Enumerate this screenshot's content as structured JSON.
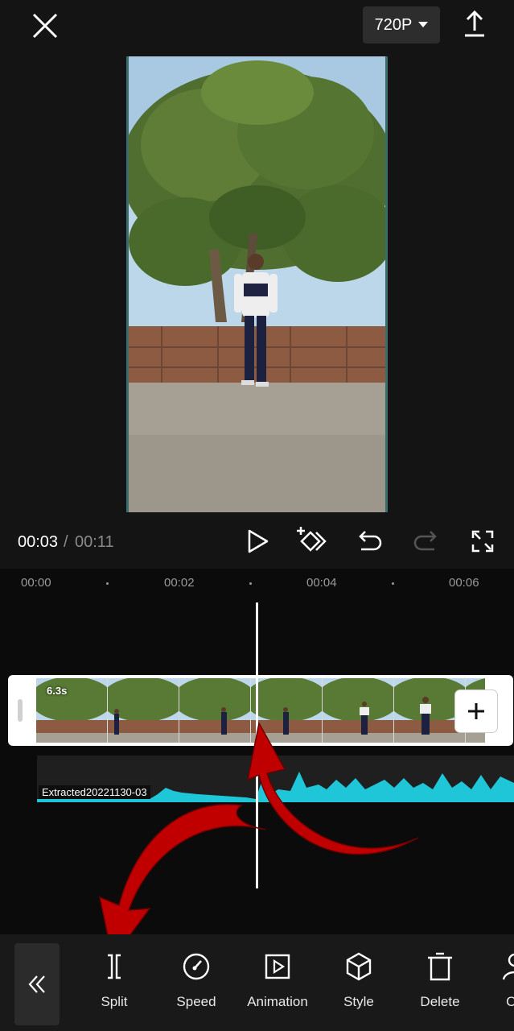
{
  "header": {
    "resolution_label": "720P"
  },
  "playback": {
    "current_time": "00:03",
    "separator": "/",
    "total_time": "00:11"
  },
  "timeline": {
    "ticks": [
      "00:00",
      "00:02",
      "00:04",
      "00:06"
    ],
    "clip_duration": "6.3s",
    "audio_label": "Extracted20221130-03"
  },
  "toolbar": {
    "items": [
      {
        "label": "Split",
        "icon": "split-icon"
      },
      {
        "label": "Speed",
        "icon": "speed-icon"
      },
      {
        "label": "Animation",
        "icon": "animation-icon"
      },
      {
        "label": "Style",
        "icon": "style-cube-icon"
      },
      {
        "label": "Delete",
        "icon": "trash-icon"
      },
      {
        "label": "Cu",
        "icon": "cutout-icon"
      }
    ]
  },
  "colors": {
    "audio_wave": "#1fc6d8",
    "annotation_arrow": "#c00000",
    "toolbar_bg": "#191919"
  }
}
